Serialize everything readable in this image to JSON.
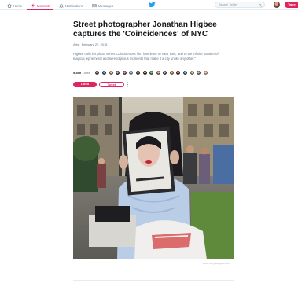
{
  "nav": {
    "items": [
      {
        "label": "Home",
        "icon": "home-icon",
        "active": false
      },
      {
        "label": "Moments",
        "icon": "lightning-icon",
        "active": true
      },
      {
        "label": "Notifications",
        "icon": "bell-icon",
        "active": false
      },
      {
        "label": "Messages",
        "icon": "envelope-icon",
        "active": false
      }
    ],
    "search_placeholder": "Search Twitter",
    "tweet_label": "Twee"
  },
  "colors": {
    "accent": "#e0245e",
    "brand": "#1da1f2",
    "muted": "#657786"
  },
  "article": {
    "title": "Street photographer Jonathan Higbee captures the 'Coincidences' of NYC",
    "category": "Arts",
    "date": "February 27, 2018",
    "description": "Higbee calls his photo series Coincidences his \"love letter to New York, and to the infinite number of magical, ephemeral and serendipitous moments that make it a city unlike any other.\"",
    "likes_count": "5,399",
    "likes_label": "Likes",
    "liked_label": "Liked",
    "tweet_label": "Tweet",
    "photo_credit": "Photo via @JHiggbeePhoto"
  }
}
